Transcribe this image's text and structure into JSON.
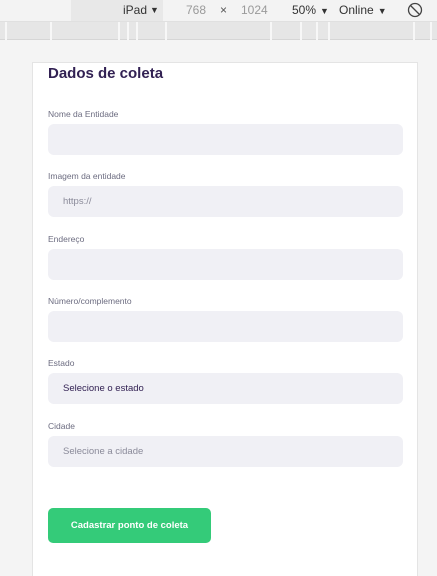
{
  "devtools": {
    "device": "iPad",
    "width": "768",
    "times": "×",
    "height": "1024",
    "zoom": "50%",
    "throttle": "Online",
    "arrow": "▼"
  },
  "form": {
    "title": "Dados de coleta",
    "fields": [
      {
        "label": "Nome da Entidade",
        "value": ""
      },
      {
        "label": "Imagem da entidade",
        "placeholder": "https://"
      },
      {
        "label": "Endereço",
        "value": ""
      },
      {
        "label": "Número/complemento",
        "value": ""
      },
      {
        "label": "Estado",
        "value": "Selecione o estado"
      },
      {
        "label": "Cidade",
        "placeholder": "Selecione a cidade"
      }
    ],
    "submit_label": "Cadastrar ponto de coleta"
  },
  "colors": {
    "accent": "#34cb79",
    "title": "#322153",
    "input_bg": "#f0f0f5"
  }
}
